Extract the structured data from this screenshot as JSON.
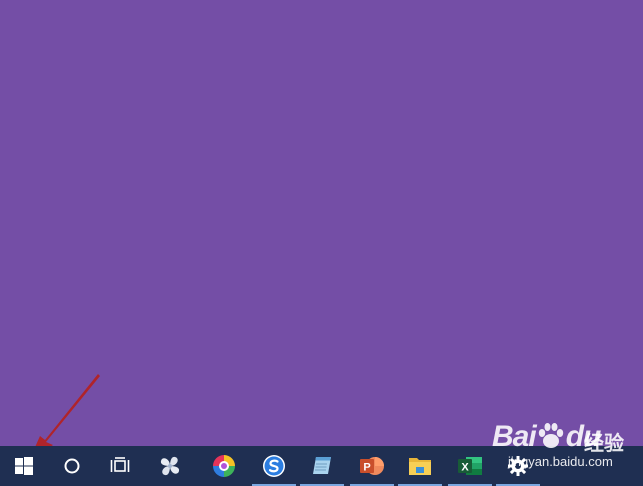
{
  "desktop": {
    "background_color": "#744ea6"
  },
  "annotation": {
    "color": "#b0242a",
    "points_to": "start-button"
  },
  "taskbar": {
    "background_color": "#1f2f52",
    "items": [
      {
        "name": "start-button",
        "icon": "windows-logo-icon",
        "active": false
      },
      {
        "name": "search-button",
        "icon": "cortana-circle-icon",
        "active": false
      },
      {
        "name": "task-view-button",
        "icon": "task-view-icon",
        "active": false
      },
      {
        "name": "app-pinwheel",
        "icon": "pinwheel-app-icon",
        "active": false
      },
      {
        "name": "app-colorful",
        "icon": "colorful-ring-icon",
        "active": false
      },
      {
        "name": "app-sogou",
        "icon": "sogou-s-icon",
        "active": true
      },
      {
        "name": "app-notepad",
        "icon": "notepad-icon",
        "active": true
      },
      {
        "name": "app-powerpoint",
        "icon": "powerpoint-icon",
        "active": true
      },
      {
        "name": "app-file-explorer",
        "icon": "folder-icon",
        "active": true
      },
      {
        "name": "app-excel",
        "icon": "excel-icon",
        "active": true
      },
      {
        "name": "app-settings",
        "icon": "gear-icon",
        "active": true
      }
    ],
    "powerpoint_letter": "P",
    "excel_letter": "X"
  },
  "watermark": {
    "brand": "Bai",
    "brand_suffix": "du",
    "product": "经验",
    "url": "jingyan.baidu.com"
  }
}
